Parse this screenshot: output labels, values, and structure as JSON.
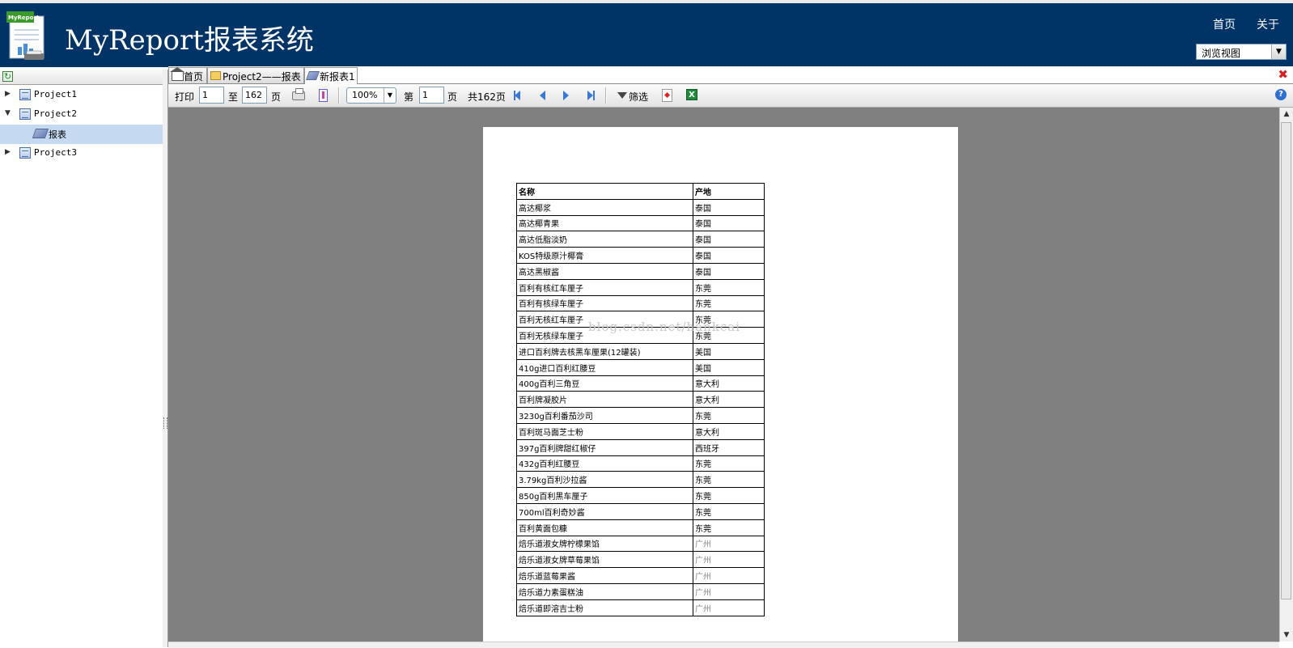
{
  "app": {
    "title": "MyReport报表系统",
    "logo_text": "MyReport",
    "nav": [
      "首页",
      "关于"
    ],
    "view_select": "浏览视图"
  },
  "tree": {
    "items": [
      {
        "label": "Project1",
        "expanded": false
      },
      {
        "label": "Project2",
        "expanded": true
      },
      {
        "label": "报表",
        "selected": true
      },
      {
        "label": "Project3",
        "expanded": false
      }
    ]
  },
  "tabs": [
    {
      "label": "首页",
      "icon": "home-icon"
    },
    {
      "label": "Project2——报表",
      "icon": "folder-icon"
    },
    {
      "label": "新报表1",
      "icon": "report-icon",
      "active": true
    }
  ],
  "toolbar": {
    "print_label": "打印",
    "from_value": "1",
    "to_label": "至",
    "to_value": "162",
    "page_unit": "页",
    "zoom": "100%",
    "page_prefix": "第",
    "current_page": "1",
    "page_suffix": "页",
    "total_pages": "共162页",
    "filter_label": "筛选",
    "help": "?"
  },
  "report": {
    "headers": [
      "名称",
      "产地"
    ],
    "rows": [
      [
        "高达椰浆",
        "泰国"
      ],
      [
        "高达椰青果",
        "泰国"
      ],
      [
        "高达低脂淡奶",
        "泰国"
      ],
      [
        "KOS特级原汁椰膏",
        "泰国"
      ],
      [
        "高达黑椒酱",
        "泰国"
      ],
      [
        "百利有核红车厘子",
        "东莞"
      ],
      [
        "百利有核绿车厘子",
        "东莞"
      ],
      [
        "百利无核红车厘子",
        "东莞"
      ],
      [
        "百利无核绿车厘子",
        "东莞"
      ],
      [
        "进口百利牌去核黑车厘果(12罐装)",
        "美国"
      ],
      [
        "410g进口百利红腰豆",
        "美国"
      ],
      [
        "400g百利三角豆",
        "意大利"
      ],
      [
        "百利牌凝胶片",
        "意大利"
      ],
      [
        "3230g百利番茄沙司",
        "东莞"
      ],
      [
        "百利斑马面芝士粉",
        "意大利"
      ],
      [
        "397g百利牌甜红椒仔",
        "西班牙"
      ],
      [
        "432g百利红腰豆",
        "东莞"
      ],
      [
        "3.79kg百利沙拉酱",
        "东莞"
      ],
      [
        "850g百利黑车厘子",
        "东莞"
      ],
      [
        "700ml百利奇妙酱",
        "东莞"
      ],
      [
        "百利黄面包糠",
        "东莞"
      ],
      [
        "焙乐道淑女牌柠檬果馅",
        "广州"
      ],
      [
        "焙乐道淑女牌草莓果馅",
        "广州"
      ],
      [
        "焙乐道蓝莓果酱",
        "广州"
      ],
      [
        "焙乐道力素蛋糕油",
        "广州"
      ],
      [
        "焙乐道即溶吉士粉",
        "广州"
      ]
    ],
    "watermark": "blog.csdn.net/hankcai",
    "faded_color": "#888888"
  }
}
